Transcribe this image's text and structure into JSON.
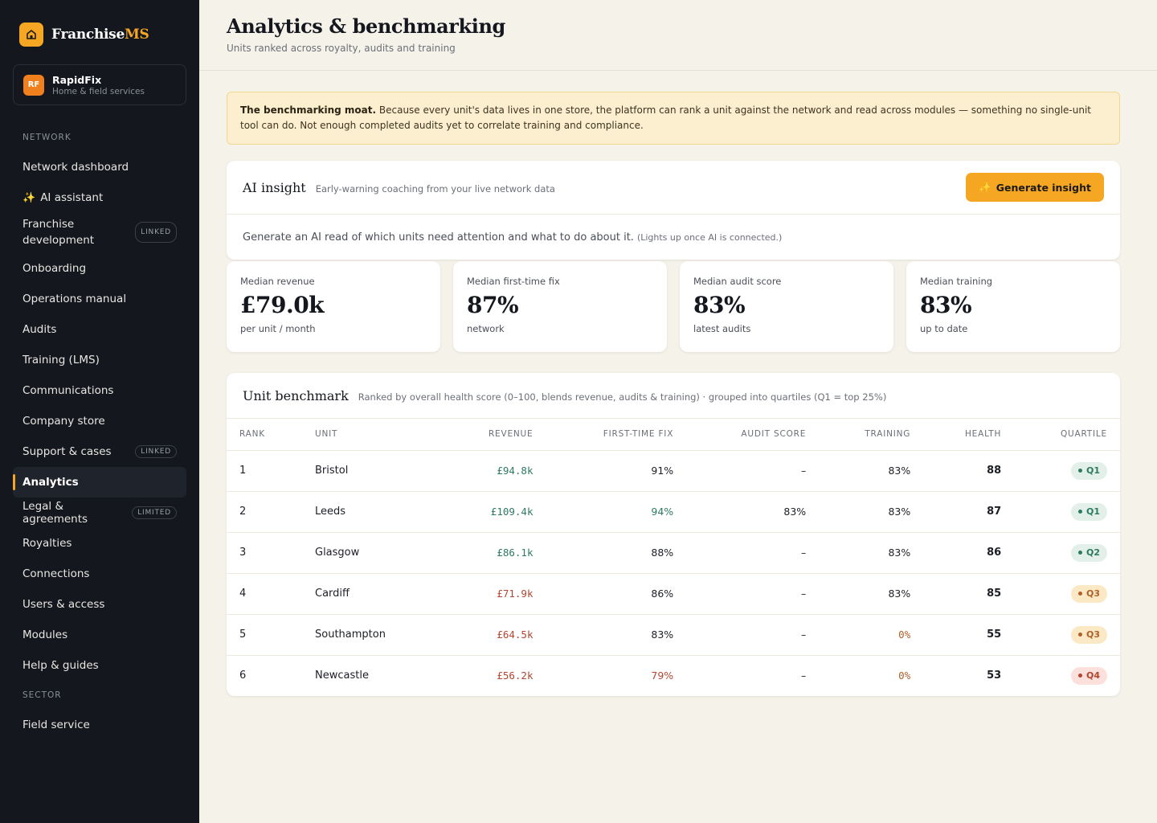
{
  "brand": {
    "name_main": "Franchise",
    "name_accent": "MS"
  },
  "tenant": {
    "initials": "RF",
    "name": "RapidFix",
    "subtitle": "Home & field services"
  },
  "sidebar": {
    "section_network": "NETWORK",
    "section_sector": "SECTOR",
    "items": [
      {
        "label": "Network dashboard"
      },
      {
        "label": "AI assistant",
        "icon": "sparkle-icon"
      },
      {
        "label": "Franchise development",
        "badge": "LINKED"
      },
      {
        "label": "Onboarding"
      },
      {
        "label": "Operations manual"
      },
      {
        "label": "Audits"
      },
      {
        "label": "Training (LMS)"
      },
      {
        "label": "Communications"
      },
      {
        "label": "Company store"
      },
      {
        "label": "Support & cases",
        "badge": "LINKED"
      },
      {
        "label": "Analytics",
        "active": true
      },
      {
        "label": "Legal & agreements",
        "badge": "LIMITED"
      },
      {
        "label": "Royalties"
      },
      {
        "label": "Connections"
      },
      {
        "label": "Users & access"
      },
      {
        "label": "Modules"
      },
      {
        "label": "Help & guides"
      }
    ],
    "sector_items": [
      {
        "label": "Field service"
      }
    ]
  },
  "header": {
    "title": "Analytics & benchmarking",
    "subtitle": "Units ranked across royalty, audits and training"
  },
  "notice": {
    "title": "The benchmarking moat.",
    "text": "Because every unit's data lives in one store, the platform can rank a unit against the network and read across modules — something no single-unit tool can do. Not enough completed audits yet to correlate training and compliance."
  },
  "ai_insight": {
    "title": "AI insight",
    "subtitle": "Early-warning coaching from your live network data",
    "button_label": "Generate insight",
    "body": "Generate an AI read of which units need attention and what to do about it.",
    "body_note": "(Lights up once AI is connected.)"
  },
  "stats": [
    {
      "label": "Median revenue",
      "value": "£79.0k",
      "foot": "per unit / month"
    },
    {
      "label": "Median first-time fix",
      "value": "87%",
      "foot": "network"
    },
    {
      "label": "Median audit score",
      "value": "83%",
      "foot": "latest audits"
    },
    {
      "label": "Median training",
      "value": "83%",
      "foot": "up to date"
    }
  ],
  "benchmark": {
    "title": "Unit benchmark",
    "subtitle": "Ranked by overall health score (0–100, blends revenue, audits & training) · grouped into quartiles (Q1 = top 25%)",
    "columns": [
      "RANK",
      "UNIT",
      "REVENUE",
      "FIRST-TIME FIX",
      "AUDIT SCORE",
      "TRAINING",
      "HEALTH",
      "QUARTILE"
    ],
    "rows": [
      {
        "rank": "1",
        "unit": "Bristol",
        "revenue": "£94.8k",
        "revenue_tone": "good",
        "ftf": "91%",
        "ftf_tone": "",
        "audit": "–",
        "training": "83%",
        "training_tone": "",
        "health": "88",
        "quartile": "Q1",
        "q_tone": "green"
      },
      {
        "rank": "2",
        "unit": "Leeds",
        "revenue": "£109.4k",
        "revenue_tone": "good",
        "ftf": "94%",
        "ftf_tone": "good",
        "audit": "83%",
        "training": "83%",
        "training_tone": "",
        "health": "87",
        "quartile": "Q1",
        "q_tone": "green"
      },
      {
        "rank": "3",
        "unit": "Glasgow",
        "revenue": "£86.1k",
        "revenue_tone": "good",
        "ftf": "88%",
        "ftf_tone": "",
        "audit": "–",
        "training": "83%",
        "training_tone": "",
        "health": "86",
        "quartile": "Q2",
        "q_tone": "green"
      },
      {
        "rank": "4",
        "unit": "Cardiff",
        "revenue": "£71.9k",
        "revenue_tone": "bad",
        "ftf": "86%",
        "ftf_tone": "",
        "audit": "–",
        "training": "83%",
        "training_tone": "",
        "health": "85",
        "quartile": "Q3",
        "q_tone": "amber"
      },
      {
        "rank": "5",
        "unit": "Southampton",
        "revenue": "£64.5k",
        "revenue_tone": "bad",
        "ftf": "83%",
        "ftf_tone": "",
        "audit": "–",
        "training": "0%",
        "training_tone": "warn",
        "health": "55",
        "quartile": "Q3",
        "q_tone": "amber"
      },
      {
        "rank": "6",
        "unit": "Newcastle",
        "revenue": "£56.2k",
        "revenue_tone": "bad",
        "ftf": "79%",
        "ftf_tone": "bad",
        "audit": "–",
        "training": "0%",
        "training_tone": "warn",
        "health": "53",
        "quartile": "Q4",
        "q_tone": "red"
      }
    ]
  },
  "colors": {
    "accent": "#f5a623",
    "sidebar_bg": "#14171e",
    "good": "#2d7a62",
    "warn": "#b0602a",
    "bad": "#b4452f"
  }
}
